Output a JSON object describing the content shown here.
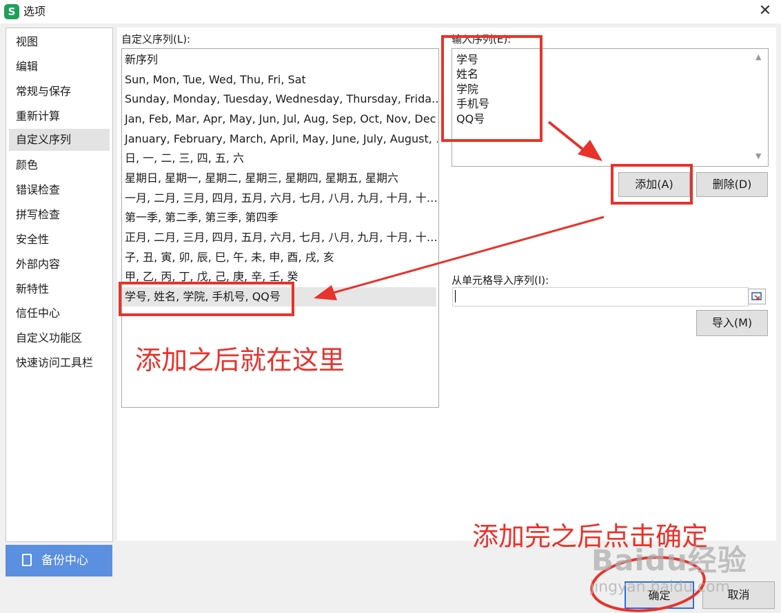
{
  "window": {
    "title": "选项",
    "app_icon_letter": "S"
  },
  "sidebar": {
    "items": [
      "视图",
      "编辑",
      "常规与保存",
      "重新计算",
      "自定义序列",
      "颜色",
      "错误检查",
      "拼写检查",
      "安全性",
      "外部内容",
      "新特性",
      "信任中心",
      "自定义功能区",
      "快速访问工具栏"
    ],
    "active": "自定义序列",
    "backup_label": "备份中心"
  },
  "custom_list": {
    "label": "自定义序列(L):",
    "rows": [
      "新序列",
      "Sun, Mon, Tue, Wed, Thu, Fri, Sat",
      "Sunday, Monday, Tuesday, Wednesday, Thursday, Frida…",
      "Jan, Feb, Mar, Apr, May, Jun, Jul, Aug, Sep, Oct, Nov, Dec",
      "January, February, March, April, May, June, July, August, …",
      "日, 一, 二, 三, 四, 五, 六",
      "星期日, 星期一, 星期二, 星期三, 星期四, 星期五, 星期六",
      "一月, 二月, 三月, 四月, 五月, 六月, 七月, 八月, 九月, 十月, 十…",
      "第一季, 第二季, 第三季, 第四季",
      "正月, 二月, 三月, 四月, 五月, 六月, 七月, 八月, 九月, 十月, 十…",
      "子, 丑, 寅, 卯, 辰, 巳, 午, 未, 申, 酉, 戌, 亥",
      "甲, 乙, 丙, 丁, 戊, 己, 庚, 辛, 壬, 癸",
      "学号, 姓名, 学院, 手机号, QQ号"
    ],
    "selected_row": "学号, 姓名, 学院, 手机号, QQ号"
  },
  "entries": {
    "label": "输入序列(E):",
    "lines": [
      "学号",
      "姓名",
      "学院",
      "手机号",
      "QQ号"
    ]
  },
  "buttons": {
    "add": "添加(A)",
    "delete": "删除(D)",
    "import": "导入(M)",
    "ok": "确定",
    "cancel": "取消"
  },
  "import_from_cells": {
    "label": "从单元格导入序列(I):",
    "value": ""
  },
  "annotations": {
    "added_here": "添加之后就在这里",
    "click_ok": "添加完之后点击确定",
    "color": "#e8322b"
  },
  "watermark": {
    "logo": "Baidu经验",
    "url": "jingyan.baidu.com"
  }
}
